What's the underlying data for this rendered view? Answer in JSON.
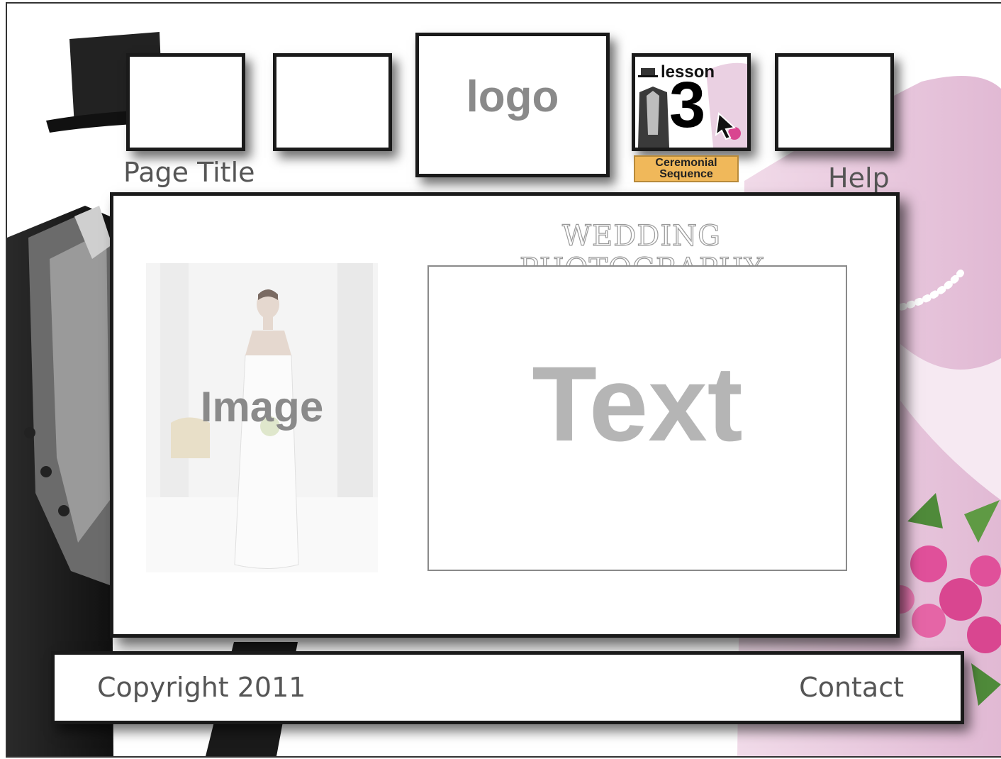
{
  "header": {
    "logo_text": "logo",
    "page_title": "Page Title",
    "help_label": "Help",
    "lesson": {
      "word": "lesson",
      "number": "3",
      "badge_line1": "Ceremonial",
      "badge_line2": "Sequence"
    }
  },
  "main": {
    "section_title": "WEDDING PHOTOGRAPHY",
    "image_placeholder": "Image",
    "text_placeholder": "Text"
  },
  "footer": {
    "copyright": "Copyright 2011",
    "contact": "Contact"
  },
  "colors": {
    "frame": "#1a1a1a",
    "placeholder_gray": "#8a8a8a",
    "badge": "#f0b85a",
    "bride_pink": "#e6c2dc",
    "roses": "#e0509a"
  }
}
